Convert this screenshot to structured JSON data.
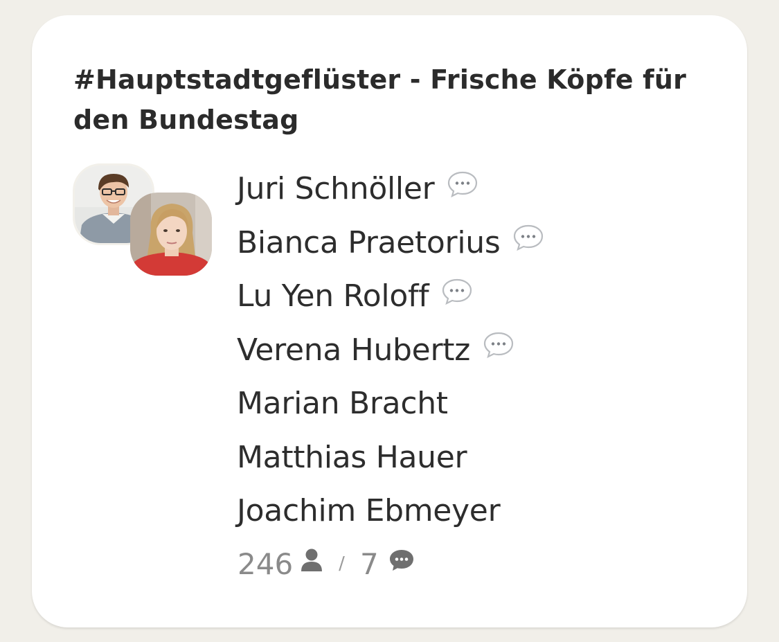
{
  "room": {
    "title": "#Hauptstadtgeflüster - Frische Köpfe für den Bundestag",
    "speakers": [
      {
        "name": "Juri Schnöller",
        "has_chat_icon": true
      },
      {
        "name": "Bianca Praetorius",
        "has_chat_icon": true
      },
      {
        "name": "Lu Yen Roloff",
        "has_chat_icon": true
      },
      {
        "name": "Verena Hubertz",
        "has_chat_icon": true
      },
      {
        "name": "Marian Bracht",
        "has_chat_icon": false
      },
      {
        "name": "Matthias Hauer",
        "has_chat_icon": false
      },
      {
        "name": "Joachim Ebmeyer",
        "has_chat_icon": false
      }
    ],
    "stats": {
      "listener_count": "246",
      "listener_icon": "person-icon",
      "separator": "/",
      "speaker_count": "7",
      "speaker_icon": "chat-bubble-icon"
    }
  },
  "colors": {
    "background": "#f1efe9",
    "card": "#ffffff",
    "text": "#2d2d2d",
    "muted": "#8a8a8a"
  }
}
